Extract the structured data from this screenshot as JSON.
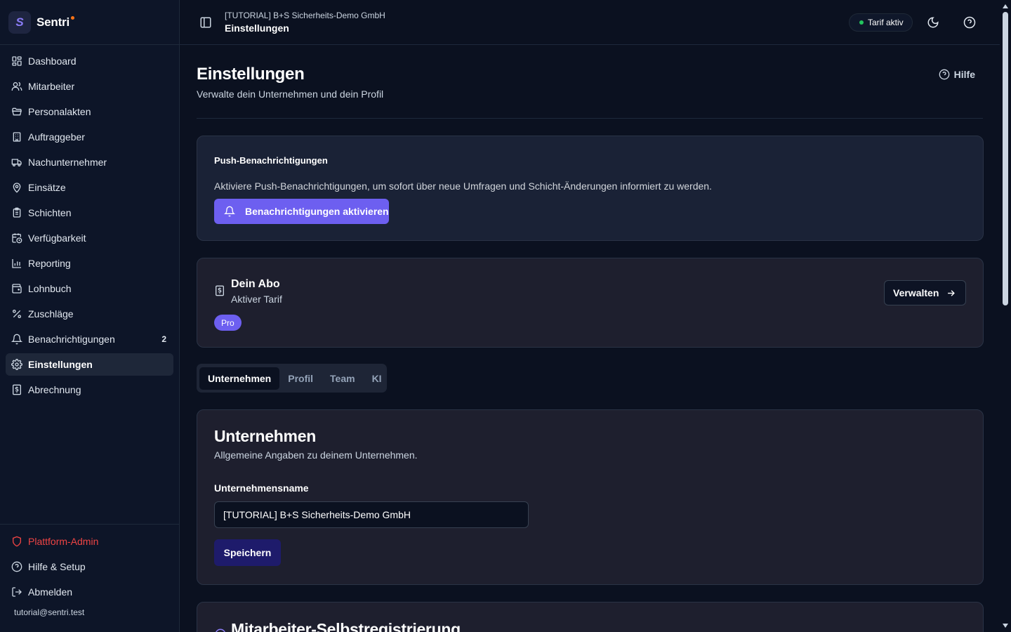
{
  "brand": {
    "name": "Sentri",
    "logo_letter": "S"
  },
  "sidebar": {
    "items": [
      {
        "label": "Dashboard",
        "icon": "dashboard-icon"
      },
      {
        "label": "Mitarbeiter",
        "icon": "users-icon"
      },
      {
        "label": "Personalakten",
        "icon": "folder-icon"
      },
      {
        "label": "Auftraggeber",
        "icon": "building-icon"
      },
      {
        "label": "Nachunternehmer",
        "icon": "truck-icon"
      },
      {
        "label": "Einsätze",
        "icon": "map-pin-icon"
      },
      {
        "label": "Schichten",
        "icon": "clipboard-icon"
      },
      {
        "label": "Verfügbarkeit",
        "icon": "calendar-clock-icon"
      },
      {
        "label": "Reporting",
        "icon": "bar-chart-icon"
      },
      {
        "label": "Lohnbuch",
        "icon": "wallet-icon"
      },
      {
        "label": "Zuschläge",
        "icon": "percent-icon"
      },
      {
        "label": "Benachrichtigungen",
        "icon": "bell-icon",
        "badge": "2"
      },
      {
        "label": "Einstellungen",
        "icon": "gear-icon",
        "active": true
      },
      {
        "label": "Abrechnung",
        "icon": "receipt-icon"
      }
    ],
    "bottom": {
      "admin_label": "Plattform-Admin",
      "help_label": "Hilfe & Setup",
      "logout_label": "Abmelden",
      "user_email": "tutorial@sentri.test"
    }
  },
  "topbar": {
    "company": "[TUTORIAL] B+S Sicherheits-Demo GmbH",
    "page": "Einstellungen",
    "plan_status": "Tarif aktiv"
  },
  "page": {
    "title": "Einstellungen",
    "subtitle": "Verwalte dein Unternehmen und dein Profil",
    "help_label": "Hilfe"
  },
  "push": {
    "title": "Push-Benachrichtigungen",
    "description": "Aktiviere Push-Benachrichtigungen, um sofort über neue Umfragen und Schicht-Änderungen informiert zu werden.",
    "button_label": "Benachrichtigungen aktivieren"
  },
  "subscription": {
    "title": "Dein Abo",
    "subtitle": "Aktiver Tarif",
    "plan_badge": "Pro",
    "manage_label": "Verwalten"
  },
  "tabs": [
    "Unternehmen",
    "Profil",
    "Team",
    "KI"
  ],
  "company_section": {
    "title": "Unternehmen",
    "subtitle": "Allgemeine Angaben zu deinem Unternehmen.",
    "name_label": "Unternehmensname",
    "name_value": "[TUTORIAL] B+S Sicherheits-Demo GmbH",
    "save_label": "Speichern"
  },
  "registration_section": {
    "title": "Mitarbeiter-Selbstregistrierung"
  },
  "colors": {
    "background": "#0b1120",
    "accent": "#6d5ff0",
    "save_button": "#1e1b6b",
    "danger": "#ef4444",
    "status_dot": "#22c55e"
  }
}
